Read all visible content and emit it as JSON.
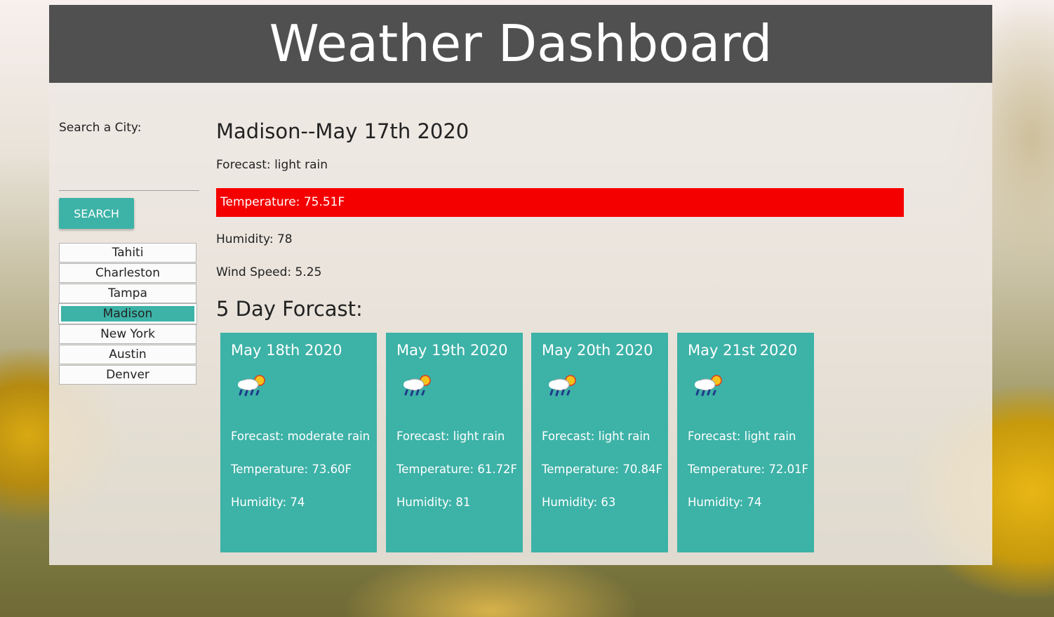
{
  "header": {
    "title": "Weather Dashboard"
  },
  "sidebar": {
    "search_label": "Search a City:",
    "search_input_value": "",
    "search_button_label": "SEARCH",
    "cities": [
      {
        "label": "Tahiti",
        "active": false
      },
      {
        "label": "Charleston",
        "active": false
      },
      {
        "label": "Tampa",
        "active": false
      },
      {
        "label": "Madison",
        "active": true
      },
      {
        "label": "New York",
        "active": false
      },
      {
        "label": "Austin",
        "active": false
      },
      {
        "label": "Denver",
        "active": false
      }
    ]
  },
  "current": {
    "title": "Madison--May 17th 2020",
    "forecast": "Forecast: light rain",
    "temperature": "Temperature: 75.51F",
    "humidity": "Humidity: 78",
    "wind": "Wind Speed: 5.25"
  },
  "five_day": {
    "title": "5 Day Forcast:",
    "cards": [
      {
        "date": "May 18th 2020",
        "icon": "rain-sun-icon",
        "forecast": "Forecast: moderate rain",
        "temperature": "Temperature: 73.60F",
        "humidity": "Humidity: 74"
      },
      {
        "date": "May 19th 2020",
        "icon": "rain-sun-icon",
        "forecast": "Forecast: light rain",
        "temperature": "Temperature: 61.72F",
        "humidity": "Humidity: 81"
      },
      {
        "date": "May 20th 2020",
        "icon": "rain-sun-icon",
        "forecast": "Forecast: light rain",
        "temperature": "Temperature: 70.84F",
        "humidity": "Humidity: 63"
      },
      {
        "date": "May 21st 2020",
        "icon": "rain-sun-icon",
        "forecast": "Forecast: light rain",
        "temperature": "Temperature: 72.01F",
        "humidity": "Humidity: 74"
      }
    ]
  },
  "colors": {
    "header_bg": "#505050",
    "accent_teal": "#3db2a7",
    "temperature_bar": "#f50000"
  }
}
